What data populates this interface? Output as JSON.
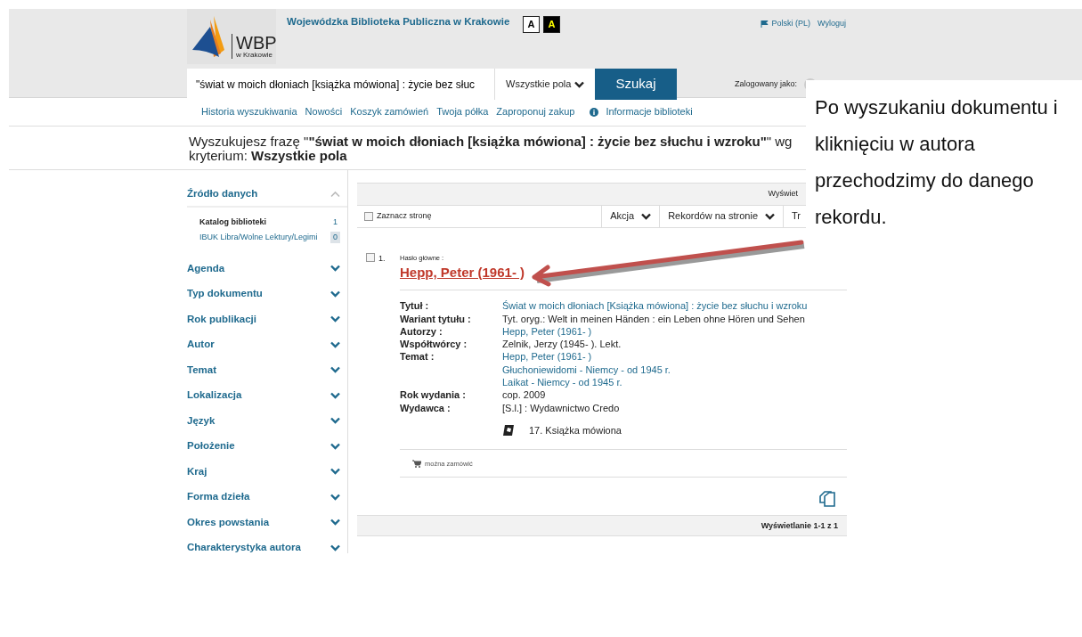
{
  "header": {
    "logo": {
      "abbr": "WBP",
      "subtitle": "w Krakowie"
    },
    "library_name": "Wojewódzka Biblioteka Publiczna w Krakowie",
    "contrast_buttons": [
      {
        "label": "A",
        "kind": "normal"
      },
      {
        "label": "A",
        "kind": "high"
      }
    ],
    "language": "Polski (PL)",
    "logout": "Wyloguj",
    "search": {
      "value": "\"świat w moich dłoniach [książka mówiona] : życie bez słuc",
      "field": "Wszystkie pola",
      "button": "Szukaj"
    },
    "logged_in_label": "Zalogowany jako:"
  },
  "nav_links": [
    {
      "label": "Historia wyszukiwania",
      "kind": "plain"
    },
    {
      "label": "Nowości",
      "kind": "plain"
    },
    {
      "label": "Koszyk zamówień",
      "kind": "plain"
    },
    {
      "label": "Twoja półka",
      "kind": "plain"
    },
    {
      "label": "Zaproponuj zakup",
      "kind": "plain"
    },
    {
      "label": "Informacje biblioteki",
      "kind": "info"
    }
  ],
  "search_summary": "Wyszukujesz frazę \"**\"świat w moich dłoniach [książka mówiona] : życie bez słuchu i wzroku\"**\" wg kryterium: **Wszystkie pola**",
  "facets": [
    {
      "label": "Źródło danych",
      "expanded": true,
      "options": [
        {
          "label": "Katalog biblioteki",
          "count": "1",
          "selected": true
        },
        {
          "label": "IBUK Libra/Wolne Lektury/Legimi",
          "count": "0",
          "selected": false
        }
      ]
    },
    {
      "label": "Agenda",
      "expanded": false
    },
    {
      "label": "Typ dokumentu",
      "expanded": false
    },
    {
      "label": "Rok publikacji",
      "expanded": false
    },
    {
      "label": "Autor",
      "expanded": false
    },
    {
      "label": "Temat",
      "expanded": false
    },
    {
      "label": "Lokalizacja",
      "expanded": false
    },
    {
      "label": "Język",
      "expanded": false
    },
    {
      "label": "Położenie",
      "expanded": false
    },
    {
      "label": "Kraj",
      "expanded": false
    },
    {
      "label": "Forma dzieła",
      "expanded": false
    },
    {
      "label": "Okres powstania",
      "expanded": false
    },
    {
      "label": "Charakterystyka autora",
      "expanded": false
    }
  ],
  "results": {
    "display_info": "Wyświet",
    "select_page": {
      "label": "Zaznacz stronę",
      "checked": false
    },
    "dropdowns": [
      "Akcja",
      "Rekordów na stronie",
      "Tr"
    ],
    "records": [
      {
        "number": "1.",
        "checked": false,
        "heading_label": "Hasło główne :",
        "heading": "Hepp, Peter (1961- )",
        "fields": [
          {
            "label": "Tytuł :",
            "values": [
              {
                "text": "Świat w moich dłoniach [Książka mówiona] : życie bez słuchu i wzroku",
                "link": true
              }
            ]
          },
          {
            "label": "Wariant tytułu :",
            "values": [
              {
                "text": "Tyt. oryg.: Welt in meinen Händen : ein Leben ohne Hören und Sehen",
                "link": false
              }
            ]
          },
          {
            "label": "Autorzy :",
            "values": [
              {
                "text": "Hepp, Peter (1961- )",
                "link": true
              }
            ]
          },
          {
            "label": "Współtwórcy :",
            "values": [
              {
                "text": "Zelnik, Jerzy (1945- ). Lekt.",
                "link": false
              }
            ]
          },
          {
            "label": "Temat :",
            "values": [
              {
                "text": "Hepp, Peter (1961- )",
                "link": true
              },
              {
                "text": "Głuchoniewidomi - Niemcy - od 1945 r.",
                "link": true
              },
              {
                "text": "Laikat - Niemcy - od 1945 r.",
                "link": true
              }
            ]
          },
          {
            "label": "Rok wydania :",
            "values": [
              {
                "text": "cop. 2009",
                "link": false
              }
            ]
          },
          {
            "label": "Wydawca :",
            "values": [
              {
                "text": "[S.l.] : Wydawnictwo Credo",
                "link": false
              }
            ]
          }
        ],
        "format": "17. Książka mówiona",
        "availability": "można zamówić"
      }
    ],
    "footer": "Wyświetlanie 1-1 z 1"
  },
  "annotation": {
    "text": "Po wyszukaniu dokumentu i kliknięciu w autora przechodzimy do danego rekordu."
  }
}
